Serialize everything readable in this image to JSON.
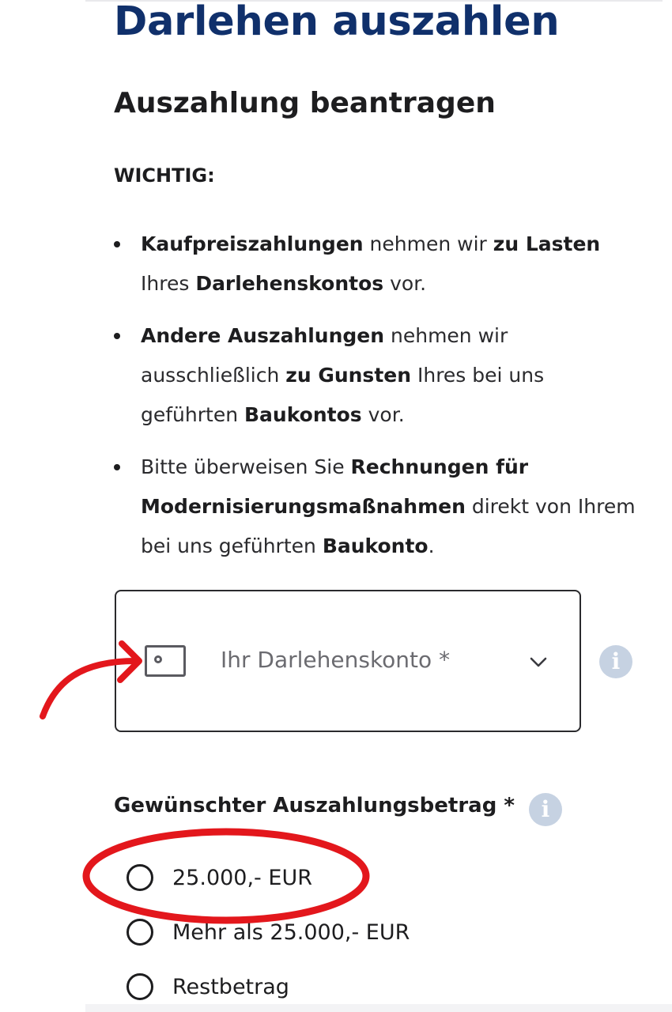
{
  "page": {
    "title": "Darlehen auszahlen",
    "section_title": "Auszahlung beantragen",
    "important_label": "WICHTIG:"
  },
  "notes": [
    {
      "segments": [
        {
          "text": "Kaufpreiszahlungen",
          "bold": true
        },
        {
          "text": " nehmen wir ",
          "bold": false
        },
        {
          "text": "zu Lasten",
          "bold": true
        },
        {
          "text": " Ihres ",
          "bold": false
        },
        {
          "text": "Darlehenskontos",
          "bold": true
        },
        {
          "text": " vor.",
          "bold": false
        }
      ]
    },
    {
      "segments": [
        {
          "text": "Andere Auszahlungen",
          "bold": true
        },
        {
          "text": " nehmen wir ausschließlich ",
          "bold": false
        },
        {
          "text": "zu Gunsten",
          "bold": true
        },
        {
          "text": " Ihres bei uns geführten ",
          "bold": false
        },
        {
          "text": "Baukontos",
          "bold": true
        },
        {
          "text": " vor.",
          "bold": false
        }
      ]
    },
    {
      "segments": [
        {
          "text": "Bitte überweisen Sie ",
          "bold": false
        },
        {
          "text": "Rechnungen für Modernisierungsmaßnahmen",
          "bold": true
        },
        {
          "text": " direkt von Ihrem bei uns geführten ",
          "bold": false
        },
        {
          "text": "Baukonto",
          "bold": true
        },
        {
          "text": ".",
          "bold": false
        }
      ]
    }
  ],
  "account_select": {
    "placeholder": "Ihr Darlehenskonto *",
    "icon": "bank-card-icon",
    "chevron_icon": "chevron-down-icon",
    "info_icon_glyph": "i"
  },
  "amount": {
    "label": "Gewünschter Auszahlungsbetrag *",
    "info_icon_glyph": "i",
    "options": [
      {
        "label": "25.000,- EUR",
        "selected": false
      },
      {
        "label": "Mehr als 25.000,- EUR",
        "selected": false
      },
      {
        "label": "Restbetrag",
        "selected": false
      }
    ]
  },
  "colors": {
    "title": "#10306b",
    "annotation": "#e3171c",
    "info_icon": "#c6d2e2"
  }
}
